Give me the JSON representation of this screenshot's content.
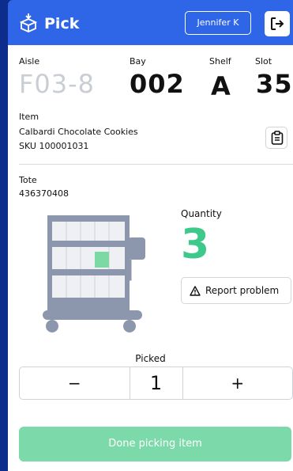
{
  "header": {
    "title": "Pick",
    "user": "Jennifer K"
  },
  "location": {
    "aisle_label": "Aisle",
    "aisle": "F03-8",
    "bay_label": "Bay",
    "bay": "002",
    "shelf_label": "Shelf",
    "shelf": "A",
    "slot_label": "Slot",
    "slot": "35"
  },
  "item": {
    "label": "Item",
    "name": "Calbardi Chocolate Cookies",
    "sku": "SKU 100001031"
  },
  "tote": {
    "label": "Tote",
    "id": "436370408"
  },
  "quantity": {
    "label": "Quantity",
    "value": "3"
  },
  "report_label": "Report problem",
  "picked": {
    "label": "Picked",
    "minus": "−",
    "value": "1",
    "plus": "+"
  },
  "done_label": "Done picking item",
  "colors": {
    "header": "#2f66e8",
    "accent": "#3ec98a",
    "done": "#7cd9a9",
    "background": "#0d2d8c"
  },
  "icons": {
    "logo": "package-icon",
    "logout": "logout-icon",
    "clipboard": "clipboard-icon",
    "warning": "warning-icon",
    "cart": "tote-cart-icon"
  }
}
